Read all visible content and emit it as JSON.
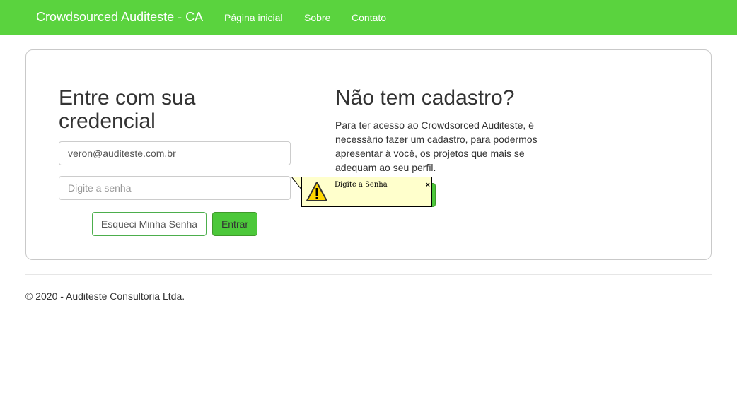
{
  "navbar": {
    "brand": "Crowdsourced Auditeste - CA",
    "links": [
      "Página inicial",
      "Sobre",
      "Contato"
    ],
    "color": "#5ad33e"
  },
  "login": {
    "title": "Entre com sua credencial",
    "email_value": "veron@auditeste.com.br",
    "password_placeholder": "Digite a senha",
    "forgot_label": "Esqueci Minha Senha",
    "enter_label": "Entrar"
  },
  "signup": {
    "title": "Não tem cadastro?",
    "text": "Para ter acesso ao Crowdsorced Auditeste, é necessário fazer um cadastro, para podermos apresentar à você, os projetos que mais se adequam ao seu perfil."
  },
  "tooltip": {
    "text": "Digite a Senha",
    "close": "×",
    "icon": "warning-icon"
  },
  "footer": {
    "text": "© 2020 - Auditeste Consultoria Ltda."
  }
}
